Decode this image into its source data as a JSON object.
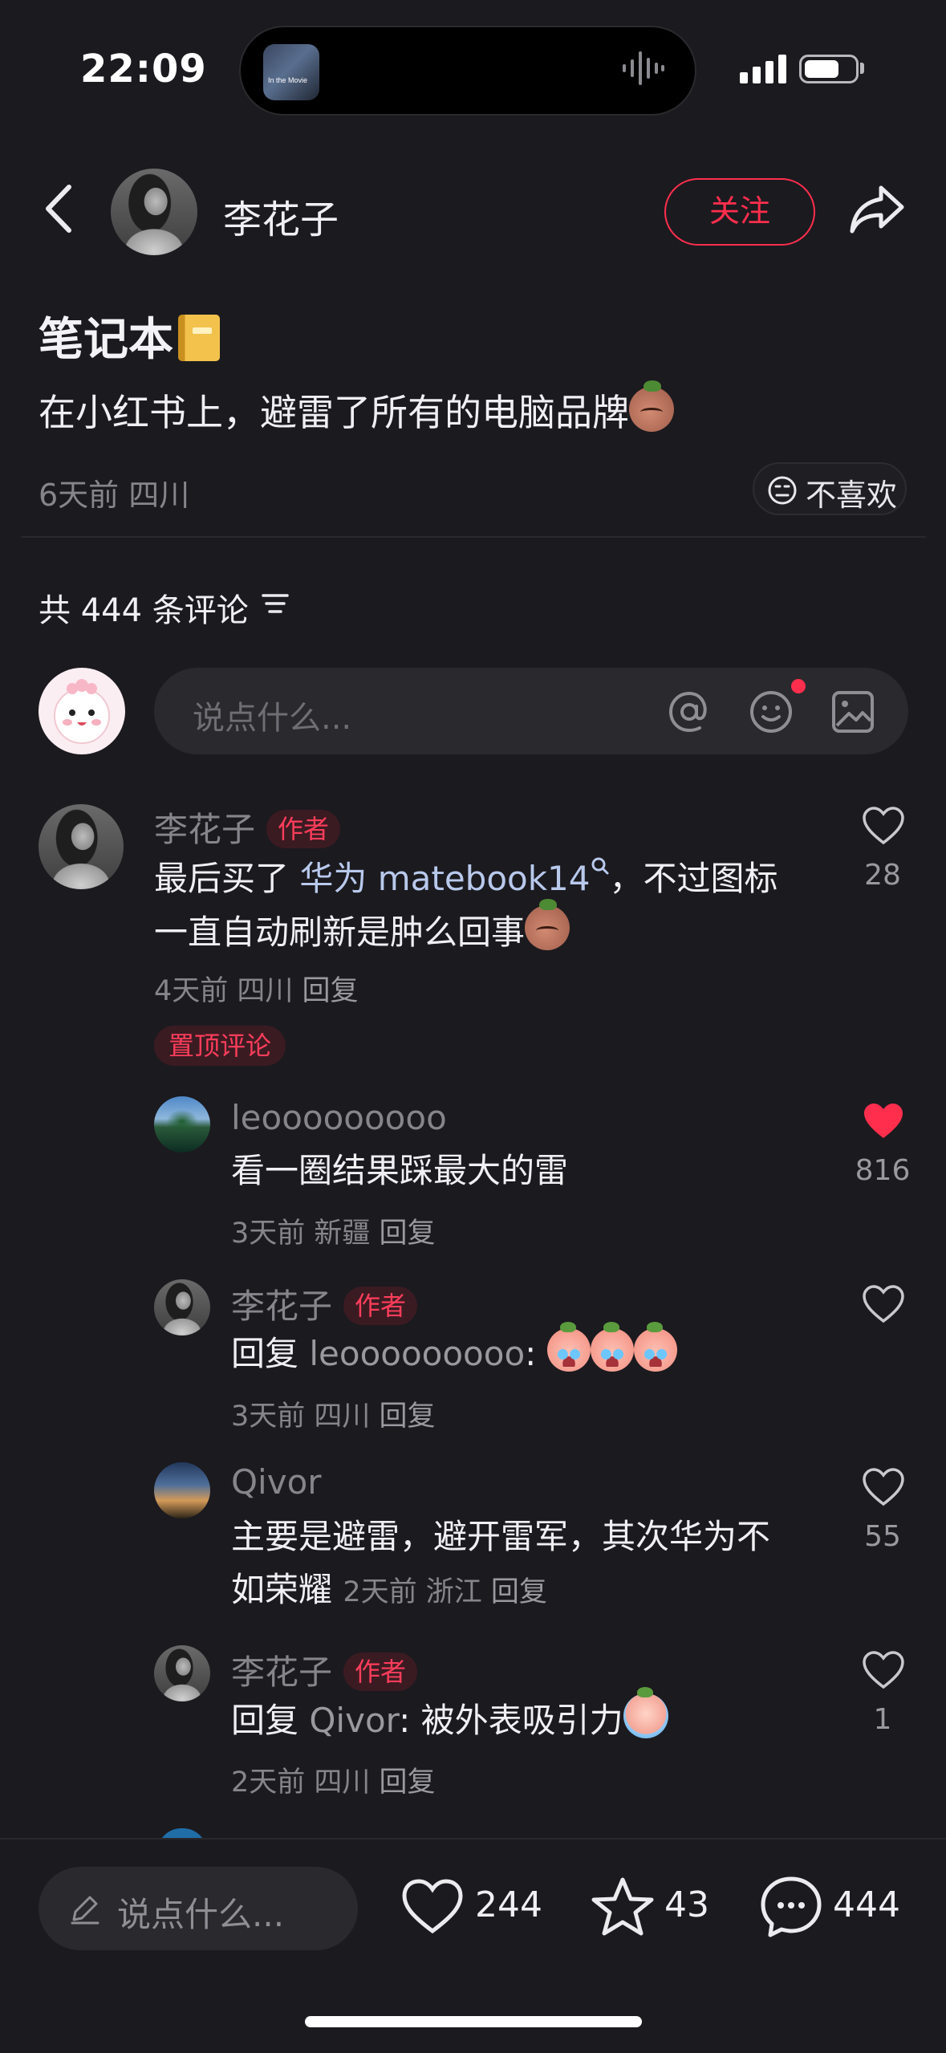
{
  "status_bar": {
    "time": "22:09",
    "now_playing_art_text": "In the Movie"
  },
  "header": {
    "author_name": "李花子",
    "follow_label": "关注"
  },
  "note": {
    "title": "笔记本",
    "text": "在小红书上，避雷了所有的电脑品牌",
    "meta": "6天前 四川",
    "dislike_label": "不喜欢"
  },
  "comments_header": {
    "total_label": "共 444 条评论"
  },
  "comment_input": {
    "placeholder": "说点什么..."
  },
  "comments": [
    {
      "user": "李花子",
      "author_tag": "作者",
      "text_pre": "最后买了 ",
      "link": "华为 matebook14",
      "text_post_line1": "，不过图标",
      "text_line2": "一直自动刷新是肿么回事",
      "meta": "4天前 四川 ",
      "reply_label": "回复",
      "likes": "28",
      "pinned_label": "置顶评论",
      "liked": false
    }
  ],
  "replies": [
    {
      "user": "leooooooooo",
      "text": "看一圈结果踩最大的雷",
      "meta": "3天前 新疆 ",
      "reply_label": "回复",
      "likes": "816",
      "liked": true
    },
    {
      "user": "李花子",
      "author_tag": "作者",
      "text_prefix": "回复 ",
      "mention": "leooooooooo",
      "text": ": ",
      "meta": "3天前 四川 ",
      "reply_label": "回复",
      "likes": "",
      "liked": false
    },
    {
      "user": "Qivor",
      "text_line1": "主要是避雷，避开雷军，其次华为不",
      "text_line2": "如荣耀",
      "meta": "2天前 浙江 ",
      "reply_label": "回复",
      "likes": "55",
      "liked": false
    },
    {
      "user": "李花子",
      "author_tag": "作者",
      "text_prefix": "回复 ",
      "mention": "Qivor",
      "text": ": 被外表吸引力",
      "meta": "2天前 四川 ",
      "reply_label": "回复",
      "likes": "1",
      "liked": false
    }
  ],
  "bottom_bar": {
    "placeholder": "说点什么...",
    "likes": "244",
    "collects": "43",
    "comments": "444"
  },
  "colors": {
    "background": "#1b1a1f",
    "accent_red": "#ff2e4d",
    "muted_text": "#86858b",
    "link_blue": "#b8c9ec"
  }
}
